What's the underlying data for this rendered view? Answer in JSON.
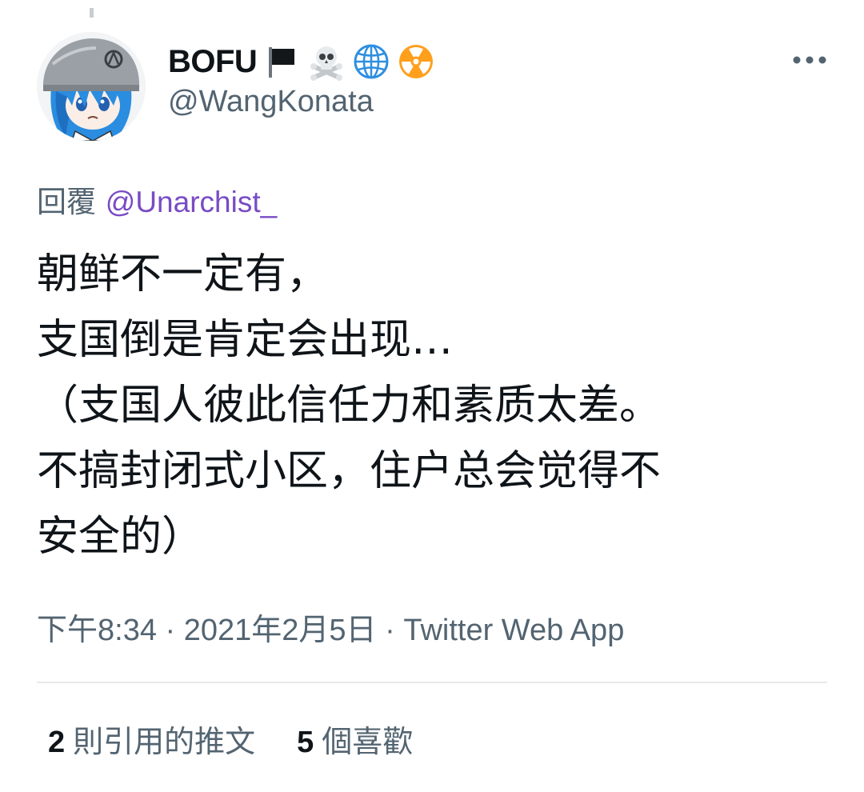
{
  "author": {
    "display_name": "BOFU",
    "name_emojis": [
      "black-flag-icon",
      "skull-and-crossbones-icon",
      "globe-icon",
      "radioactive-icon"
    ],
    "handle": "@WangKonata"
  },
  "menu": {
    "more_glyph": "•••"
  },
  "reply": {
    "prefix": "回覆",
    "mention": "@Unarchist_"
  },
  "tweet": {
    "lines": [
      "朝鲜不一定有，",
      "支国倒是肯定会出现…",
      "（支国人彼此信任力和素质太差。",
      "不搞封闭式小区，住户总会觉得不",
      "安全的）"
    ]
  },
  "meta": {
    "time": "下午8:34",
    "separator": " · ",
    "date": "2021年2月5日",
    "separator2": " · ",
    "source": "Twitter Web App"
  },
  "stats": {
    "quotes_count": "2",
    "quotes_label": "則引用的推文",
    "likes_count": "5",
    "likes_label": "個喜歡"
  },
  "colors": {
    "text_primary": "#0f1419",
    "text_secondary": "#536471",
    "mention": "#794bc4",
    "divider": "#e7e9ea"
  }
}
